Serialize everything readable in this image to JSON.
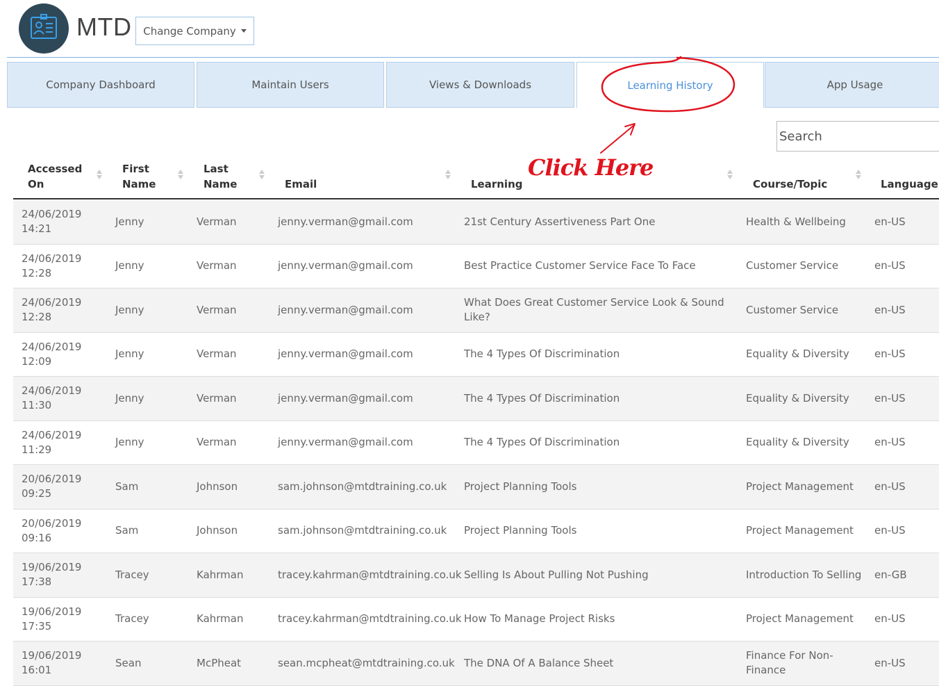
{
  "header": {
    "brand": "MTD",
    "change_company_label": "Change Company"
  },
  "tabs": [
    {
      "label": "Company Dashboard",
      "active": false
    },
    {
      "label": "Maintain Users",
      "active": false
    },
    {
      "label": "Views & Downloads",
      "active": false
    },
    {
      "label": "Learning History",
      "active": true
    },
    {
      "label": "App Usage",
      "active": false
    }
  ],
  "search": {
    "placeholder": "Search"
  },
  "annotation": {
    "text": "Click Here",
    "color": "#e0141e"
  },
  "table": {
    "headers": {
      "accessed_on_1": "Accessed",
      "accessed_on_2": "On",
      "first_name_1": "First",
      "first_name_2": "Name",
      "last_name_1": "Last",
      "last_name_2": "Name",
      "email": "Email",
      "learning": "Learning",
      "course_topic": "Course/Topic",
      "language": "Language"
    },
    "rows": [
      {
        "date": "24/06/2019",
        "time": "14:21",
        "first": "Jenny",
        "last": "Verman",
        "email": "jenny.verman@gmail.com",
        "learning": "21st Century Assertiveness Part One",
        "course": "Health & Wellbeing",
        "lang": "en-US"
      },
      {
        "date": "24/06/2019",
        "time": "12:28",
        "first": "Jenny",
        "last": "Verman",
        "email": "jenny.verman@gmail.com",
        "learning": "Best Practice Customer Service Face To Face",
        "course": "Customer Service",
        "lang": "en-US"
      },
      {
        "date": "24/06/2019",
        "time": "12:28",
        "first": "Jenny",
        "last": "Verman",
        "email": "jenny.verman@gmail.com",
        "learning": "What Does Great Customer Service Look & Sound Like?",
        "course": "Customer Service",
        "lang": "en-US"
      },
      {
        "date": "24/06/2019",
        "time": "12:09",
        "first": "Jenny",
        "last": "Verman",
        "email": "jenny.verman@gmail.com",
        "learning": "The 4 Types Of Discrimination",
        "course": "Equality & Diversity",
        "lang": "en-US"
      },
      {
        "date": "24/06/2019",
        "time": "11:30",
        "first": "Jenny",
        "last": "Verman",
        "email": "jenny.verman@gmail.com",
        "learning": "The 4 Types Of Discrimination",
        "course": "Equality & Diversity",
        "lang": "en-US"
      },
      {
        "date": "24/06/2019",
        "time": "11:29",
        "first": "Jenny",
        "last": "Verman",
        "email": "jenny.verman@gmail.com",
        "learning": "The 4 Types Of Discrimination",
        "course": "Equality & Diversity",
        "lang": "en-US"
      },
      {
        "date": "20/06/2019",
        "time": "09:25",
        "first": "Sam",
        "last": "Johnson",
        "email": "sam.johnson@mtdtraining.co.uk",
        "learning": "Project Planning Tools",
        "course": "Project Management",
        "lang": "en-US"
      },
      {
        "date": "20/06/2019",
        "time": "09:16",
        "first": "Sam",
        "last": "Johnson",
        "email": "sam.johnson@mtdtraining.co.uk",
        "learning": "Project Planning Tools",
        "course": "Project Management",
        "lang": "en-US"
      },
      {
        "date": "19/06/2019",
        "time": "17:38",
        "first": "Tracey",
        "last": "Kahrman",
        "email": "tracey.kahrman@mtdtraining.co.uk",
        "learning": "Selling Is About Pulling Not Pushing",
        "course": "Introduction To Selling",
        "lang": "en-GB"
      },
      {
        "date": "19/06/2019",
        "time": "17:35",
        "first": "Tracey",
        "last": "Kahrman",
        "email": "tracey.kahrman@mtdtraining.co.uk",
        "learning": "How To Manage Project Risks",
        "course": "Project Management",
        "lang": "en-US"
      },
      {
        "date": "19/06/2019",
        "time": "16:01",
        "first": "Sean",
        "last": "McPheat",
        "email": "sean.mcpheat@mtdtraining.co.uk",
        "learning": "The DNA Of A Balance Sheet",
        "course": "Finance For Non-Finance",
        "lang": "en-US"
      }
    ]
  }
}
